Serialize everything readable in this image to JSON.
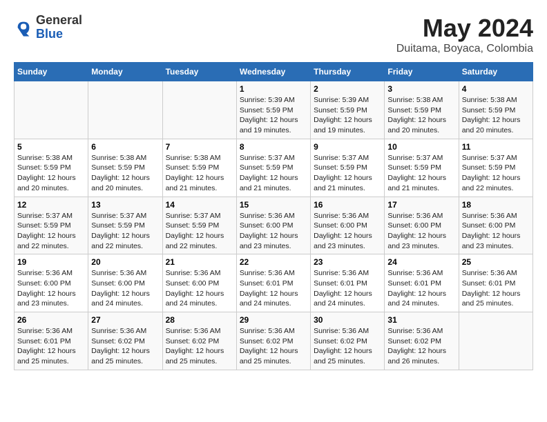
{
  "logo": {
    "general": "General",
    "blue": "Blue"
  },
  "title": "May 2024",
  "subtitle": "Duitama, Boyaca, Colombia",
  "days_header": [
    "Sunday",
    "Monday",
    "Tuesday",
    "Wednesday",
    "Thursday",
    "Friday",
    "Saturday"
  ],
  "weeks": [
    [
      {
        "day": "",
        "info": ""
      },
      {
        "day": "",
        "info": ""
      },
      {
        "day": "",
        "info": ""
      },
      {
        "day": "1",
        "info": "Sunrise: 5:39 AM\nSunset: 5:59 PM\nDaylight: 12 hours\nand 19 minutes."
      },
      {
        "day": "2",
        "info": "Sunrise: 5:39 AM\nSunset: 5:59 PM\nDaylight: 12 hours\nand 19 minutes."
      },
      {
        "day": "3",
        "info": "Sunrise: 5:38 AM\nSunset: 5:59 PM\nDaylight: 12 hours\nand 20 minutes."
      },
      {
        "day": "4",
        "info": "Sunrise: 5:38 AM\nSunset: 5:59 PM\nDaylight: 12 hours\nand 20 minutes."
      }
    ],
    [
      {
        "day": "5",
        "info": "Sunrise: 5:38 AM\nSunset: 5:59 PM\nDaylight: 12 hours\nand 20 minutes."
      },
      {
        "day": "6",
        "info": "Sunrise: 5:38 AM\nSunset: 5:59 PM\nDaylight: 12 hours\nand 20 minutes."
      },
      {
        "day": "7",
        "info": "Sunrise: 5:38 AM\nSunset: 5:59 PM\nDaylight: 12 hours\nand 21 minutes."
      },
      {
        "day": "8",
        "info": "Sunrise: 5:37 AM\nSunset: 5:59 PM\nDaylight: 12 hours\nand 21 minutes."
      },
      {
        "day": "9",
        "info": "Sunrise: 5:37 AM\nSunset: 5:59 PM\nDaylight: 12 hours\nand 21 minutes."
      },
      {
        "day": "10",
        "info": "Sunrise: 5:37 AM\nSunset: 5:59 PM\nDaylight: 12 hours\nand 21 minutes."
      },
      {
        "day": "11",
        "info": "Sunrise: 5:37 AM\nSunset: 5:59 PM\nDaylight: 12 hours\nand 22 minutes."
      }
    ],
    [
      {
        "day": "12",
        "info": "Sunrise: 5:37 AM\nSunset: 5:59 PM\nDaylight: 12 hours\nand 22 minutes."
      },
      {
        "day": "13",
        "info": "Sunrise: 5:37 AM\nSunset: 5:59 PM\nDaylight: 12 hours\nand 22 minutes."
      },
      {
        "day": "14",
        "info": "Sunrise: 5:37 AM\nSunset: 5:59 PM\nDaylight: 12 hours\nand 22 minutes."
      },
      {
        "day": "15",
        "info": "Sunrise: 5:36 AM\nSunset: 6:00 PM\nDaylight: 12 hours\nand 23 minutes."
      },
      {
        "day": "16",
        "info": "Sunrise: 5:36 AM\nSunset: 6:00 PM\nDaylight: 12 hours\nand 23 minutes."
      },
      {
        "day": "17",
        "info": "Sunrise: 5:36 AM\nSunset: 6:00 PM\nDaylight: 12 hours\nand 23 minutes."
      },
      {
        "day": "18",
        "info": "Sunrise: 5:36 AM\nSunset: 6:00 PM\nDaylight: 12 hours\nand 23 minutes."
      }
    ],
    [
      {
        "day": "19",
        "info": "Sunrise: 5:36 AM\nSunset: 6:00 PM\nDaylight: 12 hours\nand 23 minutes."
      },
      {
        "day": "20",
        "info": "Sunrise: 5:36 AM\nSunset: 6:00 PM\nDaylight: 12 hours\nand 24 minutes."
      },
      {
        "day": "21",
        "info": "Sunrise: 5:36 AM\nSunset: 6:00 PM\nDaylight: 12 hours\nand 24 minutes."
      },
      {
        "day": "22",
        "info": "Sunrise: 5:36 AM\nSunset: 6:01 PM\nDaylight: 12 hours\nand 24 minutes."
      },
      {
        "day": "23",
        "info": "Sunrise: 5:36 AM\nSunset: 6:01 PM\nDaylight: 12 hours\nand 24 minutes."
      },
      {
        "day": "24",
        "info": "Sunrise: 5:36 AM\nSunset: 6:01 PM\nDaylight: 12 hours\nand 24 minutes."
      },
      {
        "day": "25",
        "info": "Sunrise: 5:36 AM\nSunset: 6:01 PM\nDaylight: 12 hours\nand 25 minutes."
      }
    ],
    [
      {
        "day": "26",
        "info": "Sunrise: 5:36 AM\nSunset: 6:01 PM\nDaylight: 12 hours\nand 25 minutes."
      },
      {
        "day": "27",
        "info": "Sunrise: 5:36 AM\nSunset: 6:02 PM\nDaylight: 12 hours\nand 25 minutes."
      },
      {
        "day": "28",
        "info": "Sunrise: 5:36 AM\nSunset: 6:02 PM\nDaylight: 12 hours\nand 25 minutes."
      },
      {
        "day": "29",
        "info": "Sunrise: 5:36 AM\nSunset: 6:02 PM\nDaylight: 12 hours\nand 25 minutes."
      },
      {
        "day": "30",
        "info": "Sunrise: 5:36 AM\nSunset: 6:02 PM\nDaylight: 12 hours\nand 25 minutes."
      },
      {
        "day": "31",
        "info": "Sunrise: 5:36 AM\nSunset: 6:02 PM\nDaylight: 12 hours\nand 26 minutes."
      },
      {
        "day": "",
        "info": ""
      }
    ]
  ]
}
